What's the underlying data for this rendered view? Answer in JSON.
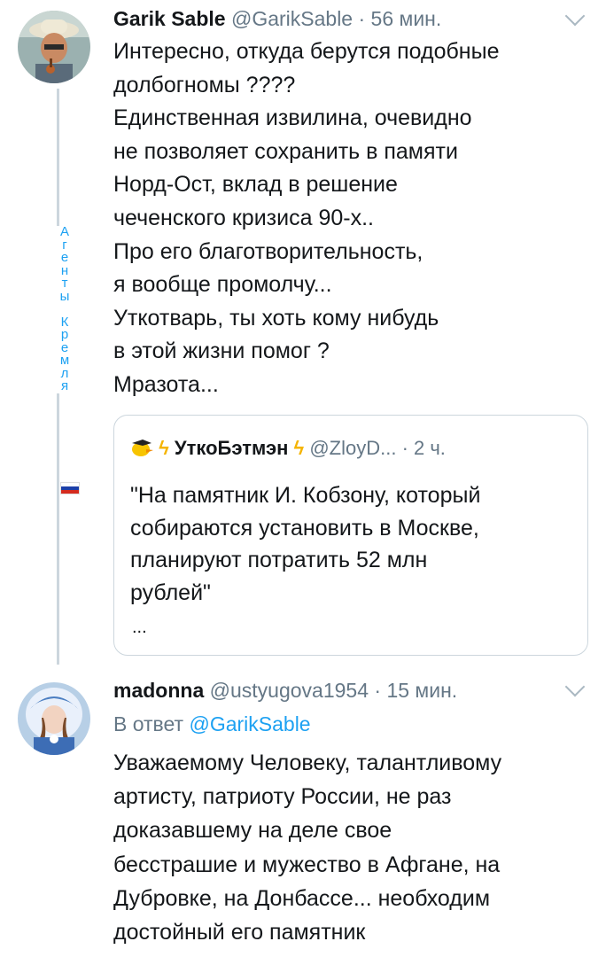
{
  "tweet1": {
    "author_name": "Garik Sable",
    "author_handle": "@GarikSable",
    "time": "· 56 мин.",
    "text_lines": [
      "Интересно, откуда берутся подобные",
      "долбогномы ????",
      "Единственная извилина, очевидно",
      "не позволяет сохранить в памяти",
      "Норд-Ост, вклад в решение",
      "чеченского кризиса 90-х..",
      "Про его благотворительность,",
      "я вообще промолчу...",
      "Уткотварь, ты хоть кому нибудь",
      "в этой жизни помог ?",
      "Мразота..."
    ],
    "quoted": {
      "emoji_icon": "duck-icon",
      "author_name": "УткоБэтмэн",
      "author_handle": "@ZloyD...",
      "time": "· 2 ч.",
      "text_lines": [
        "\"На памятник И. Кобзону, который",
        "собираются установить в Москве,",
        "планируют потратить 52 млн",
        "рублей\""
      ],
      "more": "..."
    }
  },
  "sidebar_label": [
    "А",
    "г",
    "е",
    "н",
    "т",
    "ы",
    "",
    "К",
    "р",
    "е",
    "м",
    "л",
    "я"
  ],
  "tweet2": {
    "author_name": "madonna",
    "author_handle": "@ustyugova1954",
    "time": "· 15 мин.",
    "reply_prefix": "В ответ",
    "reply_handle": "@GarikSable",
    "text_lines": [
      "Уважаемому Человеку, талантливому",
      "артисту, патриоту России, не раз",
      "доказавшему на деле свое",
      "бесстрашие и мужество в Афгане, на",
      "Дубровке, на Донбассе... необходим",
      "достойный его памятник"
    ]
  },
  "colors": {
    "link": "#1da1f2",
    "muted": "#657786",
    "line": "#ccd6dd"
  }
}
